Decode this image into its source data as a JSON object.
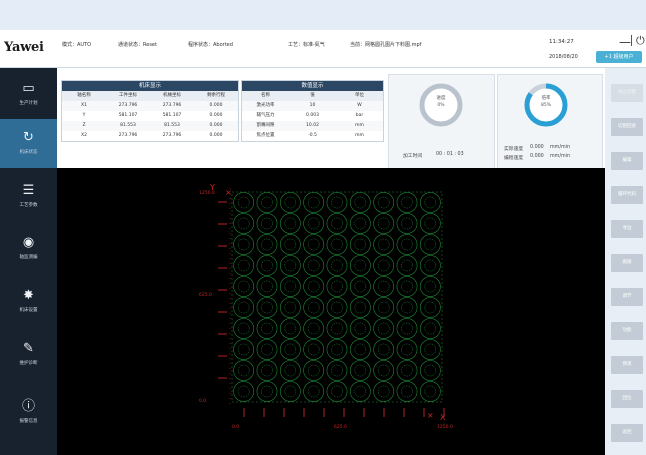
{
  "header": {
    "logo": "Yawei",
    "mode": "模式：AUTO",
    "channel_status": "通道状态：Reset",
    "run_status": "程序状态：Aborted",
    "process": "工艺：标准-氮气",
    "program": "当前：网格圆孔图片下料图.mpf",
    "time": "11:34:27",
    "date": "2018/08/20",
    "user_button": "+1 超级用户",
    "minimize_glyph": "—",
    "power_glyph": "⏻"
  },
  "nav": {
    "items": [
      {
        "label": "生产计划",
        "icon": "monitor-icon",
        "glyph": "▭"
      },
      {
        "label": "机床状态",
        "icon": "refresh-icon",
        "glyph": "↻"
      },
      {
        "label": "工艺参数",
        "icon": "process-icon",
        "glyph": "☰"
      },
      {
        "label": "轴监测编",
        "icon": "camera-icon",
        "glyph": "◉"
      },
      {
        "label": "机床设置",
        "icon": "gear-icon",
        "glyph": "✸"
      },
      {
        "label": "维护诊断",
        "icon": "wrench-icon",
        "glyph": "✎"
      },
      {
        "label": "报警信息",
        "icon": "info-icon",
        "glyph": "ⓘ"
      }
    ],
    "active_index": 1
  },
  "right_buttons": [
    {
      "label": "停止切割",
      "enabled": false
    },
    {
      "label": "切割回退",
      "enabled": true
    },
    {
      "label": "编辑",
      "enabled": true
    },
    {
      "label": "循环代码",
      "enabled": true
    },
    {
      "label": "寻边",
      "enabled": true
    },
    {
      "label": "跟随",
      "enabled": true
    },
    {
      "label": "调节",
      "enabled": true
    },
    {
      "label": "功能",
      "enabled": true
    },
    {
      "label": "预演",
      "enabled": true
    },
    {
      "label": "回位",
      "enabled": true
    },
    {
      "label": "返回",
      "enabled": true
    }
  ],
  "axis_table": {
    "title": "机床显示",
    "headers": [
      "轴名称",
      "工件坐标",
      "机械坐标",
      "剩余行程"
    ],
    "rows": [
      [
        "X1",
        "273.796",
        "273.796",
        "0.000"
      ],
      [
        "Y",
        "581.107",
        "581.107",
        "0.000"
      ],
      [
        "Z",
        "81.553",
        "81.553",
        "0.000"
      ],
      [
        "X2",
        "273.796",
        "273.796",
        "0.000"
      ]
    ]
  },
  "param_table": {
    "title": "数值显示",
    "headers": [
      "名称",
      "值",
      "单位"
    ],
    "rows": [
      [
        "激光功率",
        "10",
        "W"
      ],
      [
        "辅气压力",
        "0.003",
        "bar"
      ],
      [
        "割嘴间隙",
        "10.02",
        "mm"
      ],
      [
        "焦点位置",
        "-0.5",
        "mm"
      ]
    ]
  },
  "progress": {
    "label": "进度",
    "value": "0%",
    "fraction": 0.0,
    "time_label": "加工时间",
    "time_value": "00 : 01 : 03"
  },
  "speed": {
    "label": "倍率",
    "value": "85%",
    "fraction": 0.85,
    "actual_label": "实际速度",
    "actual_value": "0.000",
    "actual_unit": "mm/min",
    "planned_label": "编程速度",
    "planned_value": "0.000",
    "planned_unit": "mm/min"
  },
  "colors": {
    "accent": "#2f6d97",
    "ring_active": "#2a9fd6",
    "grid": "#1f8a37",
    "axis": "#c62828"
  },
  "plot": {
    "y_axis_label": "Y",
    "x_axis_label": "X",
    "y_ticks": [
      "1250.0",
      "625.0",
      "0.0"
    ],
    "x_ticks": [
      "0.0",
      "625.0",
      "1250.0"
    ],
    "grid_cols": 9,
    "grid_rows": 10
  }
}
